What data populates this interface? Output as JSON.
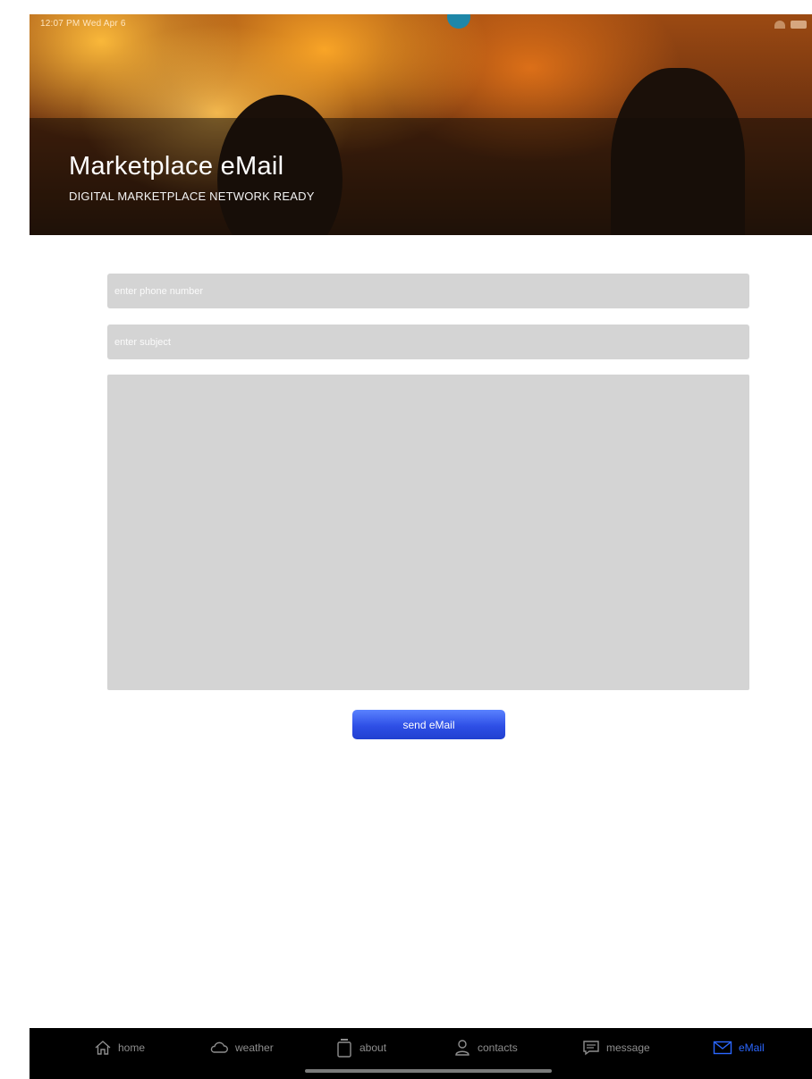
{
  "status_bar": {
    "time": "12:07 PM  Wed Apr 6"
  },
  "header": {
    "title": "Marketplace eMail",
    "subtitle": "DIGITAL MARKETPLACE NETWORK READY"
  },
  "form": {
    "phone_placeholder": "enter phone number",
    "subject_placeholder": "enter subject",
    "message_value": "",
    "send_label": "send eMail"
  },
  "tabs": [
    {
      "label": "home",
      "icon": "home-icon"
    },
    {
      "label": "weather",
      "icon": "cloud-icon"
    },
    {
      "label": "about",
      "icon": "jar-icon"
    },
    {
      "label": "contacts",
      "icon": "person-icon"
    },
    {
      "label": "message",
      "icon": "message-icon"
    },
    {
      "label": "eMail",
      "icon": "envelope-icon",
      "active": true
    }
  ],
  "colors": {
    "accent": "#2b67ff",
    "button": "#2e4fe6",
    "field_bg": "#d4d4d4",
    "tabbar_bg": "#000000",
    "tab_inactive": "#8e8e8e"
  }
}
